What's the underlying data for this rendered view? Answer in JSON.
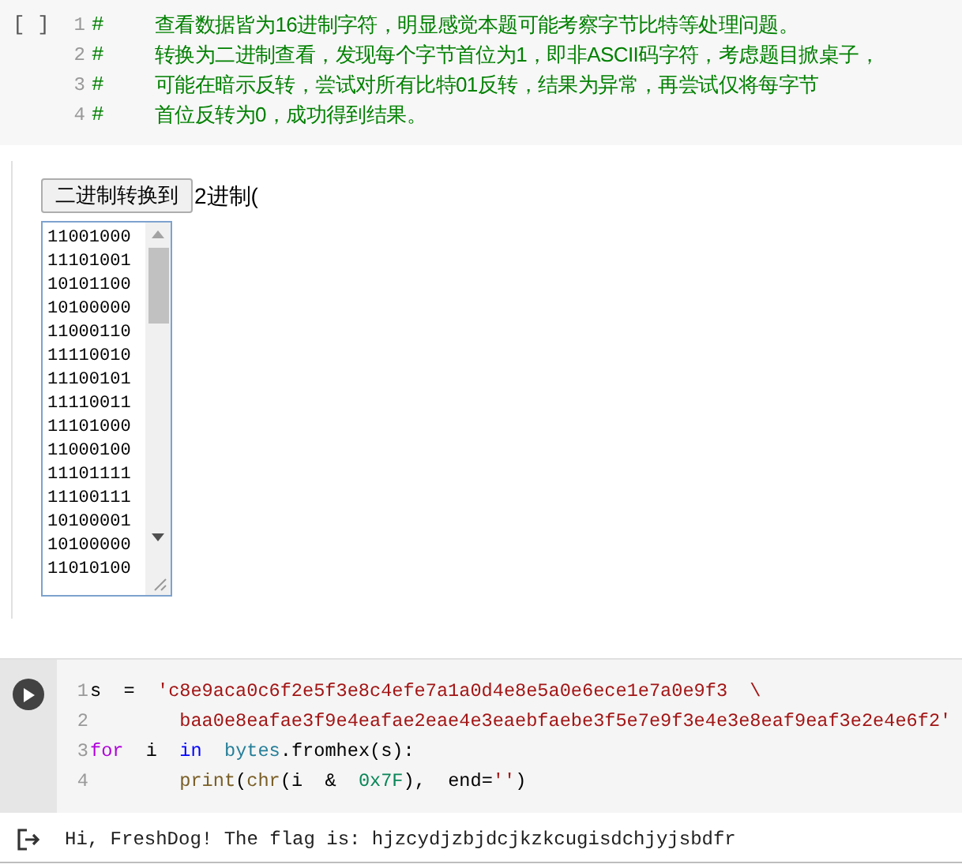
{
  "text_cell": {
    "bracket": "[ ]",
    "lines": [
      {
        "number": "1",
        "hash": "#",
        "text": "查看数据皆为16进制字符，明显感觉本题可能考察字节比特等处理问题。"
      },
      {
        "number": "2",
        "hash": "#",
        "text": "转换为二进制查看，发现每个字节首位为1，即非ASCII码字符，考虑题目掀桌子，"
      },
      {
        "number": "3",
        "hash": "#",
        "text": "可能在暗示反转，尝试对所有比特01反转，结果为异常，再尝试仅将每字节"
      },
      {
        "number": "4",
        "hash": "#",
        "text": "首位反转为0，成功得到结果。"
      }
    ]
  },
  "widget": {
    "button": "二进制转换到",
    "label": "2进制(",
    "lines": [
      "11001000",
      "11101001",
      "10101100",
      "10100000",
      "11000110",
      "11110010",
      "11100101",
      "11110011",
      "11101000",
      "11000100",
      "11101111",
      "11100111",
      "10100001",
      "10100000",
      "11010100"
    ]
  },
  "code_cell": {
    "lines": [
      {
        "number": "1",
        "tokens": [
          {
            "kind": "plain",
            "text": "s  =  "
          },
          {
            "kind": "string",
            "text": "'c8e9aca0c6f2e5f3e8c4efe7a1a0d4e8e5a0e6ece1e7a0e9f3  \\"
          }
        ]
      },
      {
        "number": "2",
        "tokens": [
          {
            "kind": "string",
            "text": "        baa0e8eafae3f9e4eafae2eae4e3eaebfaebe3f5e7e9f3e4e3e8eaf9eaf3e2e4e6f2'"
          }
        ]
      },
      {
        "number": "3",
        "tokens": [
          {
            "kind": "keyword",
            "text": "for"
          },
          {
            "kind": "plain",
            "text": "  i  "
          },
          {
            "kind": "operator",
            "text": "in  "
          },
          {
            "kind": "type",
            "text": "bytes"
          },
          {
            "kind": "plain",
            "text": ".fromhex(s):"
          }
        ]
      },
      {
        "number": "4",
        "tokens": [
          {
            "kind": "function",
            "text": "        print"
          },
          {
            "kind": "plain",
            "text": "("
          },
          {
            "kind": "function",
            "text": "chr"
          },
          {
            "kind": "plain",
            "text": "(i  &  "
          },
          {
            "kind": "number",
            "text": "0x7F"
          },
          {
            "kind": "plain",
            "text": "),  end="
          },
          {
            "kind": "string",
            "text": "''"
          },
          {
            "kind": "plain",
            "text": ")"
          }
        ]
      }
    ]
  },
  "output": {
    "text": "Hi, FreshDog! The flag is: hjzcydjzbjdcjkzkcugisdchjyjsbdfr"
  }
}
